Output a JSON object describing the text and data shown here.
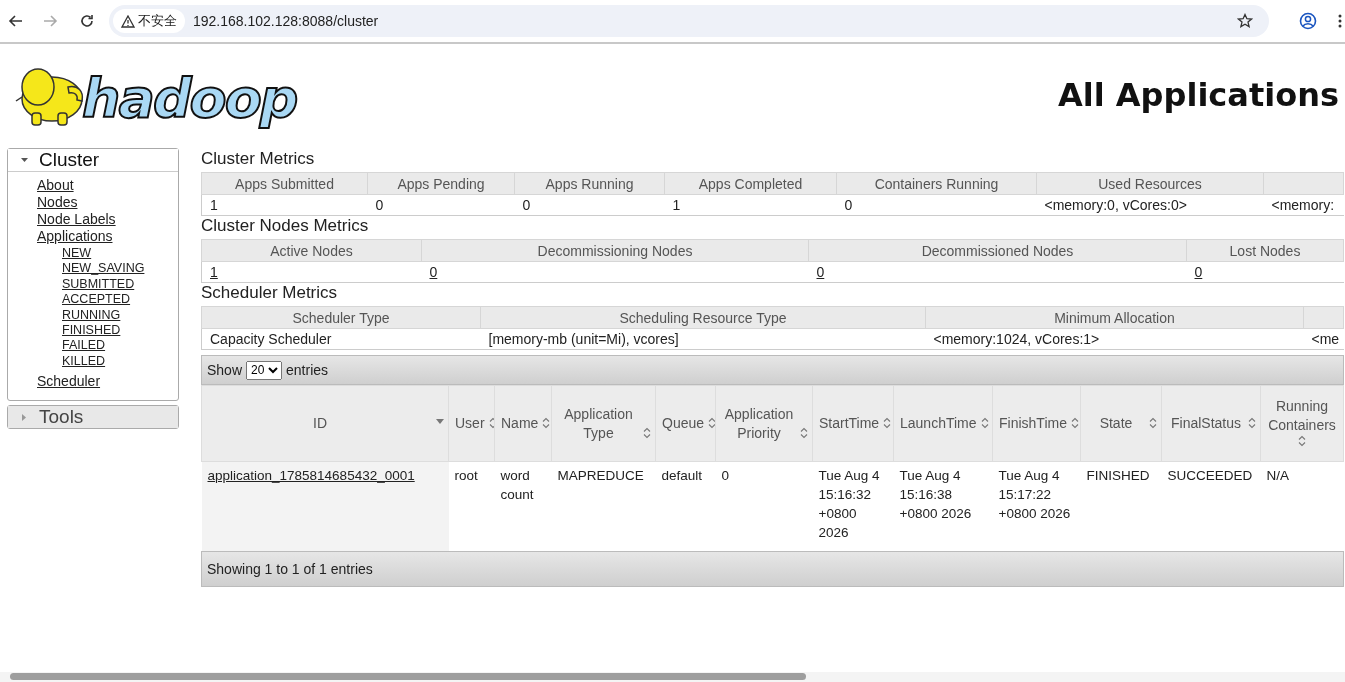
{
  "browser": {
    "nav_buttons": [
      {
        "kind": "back",
        "disabled": false
      },
      {
        "kind": "forward",
        "disabled": true
      },
      {
        "kind": "reload",
        "disabled": false
      }
    ],
    "address_bar": {
      "security_label": "不安全",
      "url": "192.168.102.128:8088/cluster"
    }
  },
  "header": {
    "logo_text": "hadoop",
    "title": "All Applications"
  },
  "sidebar": [
    {
      "label": "Cluster",
      "expanded": true,
      "items": [
        {
          "label": "About"
        },
        {
          "label": "Nodes"
        },
        {
          "label": "Node Labels"
        },
        {
          "label": "Applications",
          "children": [
            {
              "label": "NEW"
            },
            {
              "label": "NEW_SAVING"
            },
            {
              "label": "SUBMITTED"
            },
            {
              "label": "ACCEPTED"
            },
            {
              "label": "RUNNING"
            },
            {
              "label": "FINISHED"
            },
            {
              "label": "FAILED"
            },
            {
              "label": "KILLED"
            }
          ]
        },
        {
          "label": "Scheduler",
          "spaced": true
        }
      ]
    },
    {
      "label": "Tools",
      "expanded": false
    }
  ],
  "metrics": [
    {
      "title": "Cluster Metrics",
      "kind": "cluster",
      "links": false,
      "columns": [
        "Apps Submitted",
        "Apps Pending",
        "Apps Running",
        "Apps Completed",
        "Containers Running",
        "Used Resources",
        ""
      ],
      "rows": [
        [
          "1",
          "0",
          "0",
          "1",
          "0",
          "<memory:0, vCores:0>",
          "<memory:"
        ]
      ]
    },
    {
      "title": "Cluster Nodes Metrics",
      "kind": "nodes",
      "links": true,
      "columns": [
        "Active Nodes",
        "Decommissioning Nodes",
        "Decommissioned Nodes",
        "Lost Nodes"
      ],
      "rows": [
        [
          "1",
          "0",
          "0",
          "0"
        ]
      ]
    },
    {
      "title": "Scheduler Metrics",
      "kind": "scheduler",
      "links": false,
      "columns": [
        "Scheduler Type",
        "Scheduling Resource Type",
        "Minimum Allocation",
        ""
      ],
      "rows": [
        [
          "Capacity Scheduler",
          "[memory-mb (unit=Mi), vcores]",
          "<memory:1024, vCores:1>",
          "<me"
        ]
      ]
    }
  ],
  "apps": {
    "show_label": "Show",
    "page_size": "20",
    "entries_label": "entries",
    "columns": [
      {
        "label": "ID",
        "sorted": true
      },
      {
        "label": "User",
        "sorted": false
      },
      {
        "label": "Name",
        "sorted": false
      },
      {
        "label": "Application Type",
        "sorted": false
      },
      {
        "label": "Queue",
        "sorted": false
      },
      {
        "label": "Application Priority",
        "sorted": false
      },
      {
        "label": "StartTime",
        "sorted": false
      },
      {
        "label": "LaunchTime",
        "sorted": false
      },
      {
        "label": "FinishTime",
        "sorted": false
      },
      {
        "label": "State",
        "sorted": false
      },
      {
        "label": "FinalStatus",
        "sorted": false
      },
      {
        "label": "Running Containers",
        "sorted": false
      }
    ],
    "rows": [
      {
        "cells": [
          "application_1785814685432_0001",
          "root",
          "word count",
          "MAPREDUCE",
          "default",
          "0",
          "Tue Aug 4 15:16:32 +0800 2026",
          "Tue Aug 4 15:16:38 +0800 2026",
          "Tue Aug 4 15:17:22 +0800 2026",
          "FINISHED",
          "SUCCEEDED",
          "N/A"
        ]
      }
    ],
    "footer": "Showing 1 to 1 of 1 entries"
  }
}
